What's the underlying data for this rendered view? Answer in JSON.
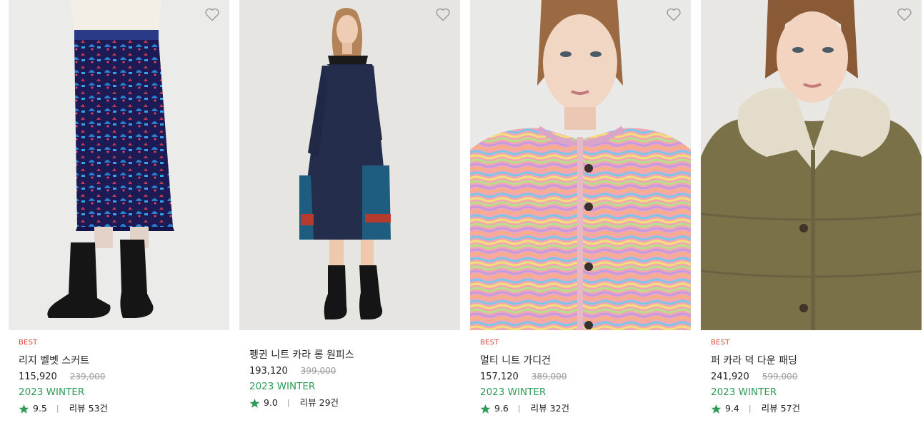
{
  "colors": {
    "badge": "#d9463c",
    "season": "#2e9b57",
    "star": "#2e9b57",
    "orig_price": "#9a9a9a"
  },
  "products": [
    {
      "badge": "BEST",
      "name": "리지 벨벳 스커트",
      "price": "115,920",
      "original_price": "239,000",
      "season": "2023 WINTER",
      "rating": "9.5",
      "review_label": "리뷰",
      "review_count": "53건",
      "image_icon": "velvet-skirt-photo"
    },
    {
      "badge": "",
      "name": "펭귄 니트 카라 롱 원피스",
      "price": "193,120",
      "original_price": "399,000",
      "season": "2023 WINTER",
      "rating": "9.0",
      "review_label": "리뷰",
      "review_count": "29건",
      "image_icon": "knit-dress-photo"
    },
    {
      "badge": "BEST",
      "name": "멀티 니트 가디건",
      "price": "157,120",
      "original_price": "389,000",
      "season": "2023 WINTER",
      "rating": "9.6",
      "review_label": "리뷰",
      "review_count": "32건",
      "image_icon": "knit-cardigan-photo"
    },
    {
      "badge": "BEST",
      "name": "퍼 카라 덕 다운 패딩",
      "price": "241,920",
      "original_price": "599,000",
      "season": "2023 WINTER",
      "rating": "9.4",
      "review_label": "리뷰",
      "review_count": "57건",
      "image_icon": "down-padding-photo"
    }
  ]
}
